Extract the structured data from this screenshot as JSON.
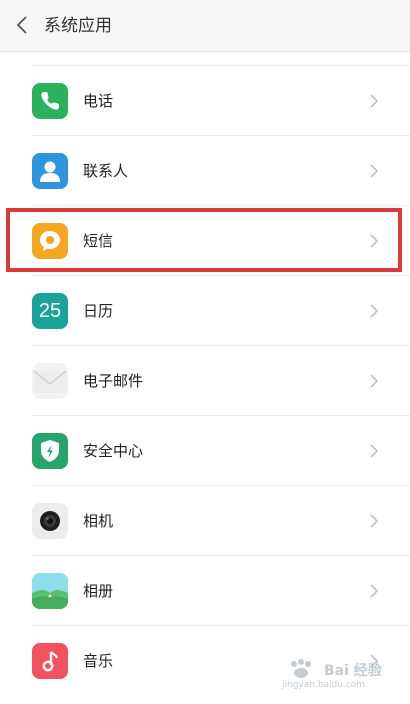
{
  "header": {
    "title": "系统应用",
    "back_icon": "chevron-left-icon"
  },
  "items": [
    {
      "label": "电话",
      "icon": "phone-icon",
      "color": "#2bb15c"
    },
    {
      "label": "联系人",
      "icon": "contacts-icon",
      "color": "#2e95dc"
    },
    {
      "label": "短信",
      "icon": "message-icon",
      "color": "#f5a623"
    },
    {
      "label": "日历",
      "icon": "calendar-icon",
      "color": "#1aa39a",
      "icon_text": "25"
    },
    {
      "label": "电子邮件",
      "icon": "email-icon",
      "color": "#ededed"
    },
    {
      "label": "安全中心",
      "icon": "security-shield-icon",
      "color": "#25a56b"
    },
    {
      "label": "相机",
      "icon": "camera-icon",
      "color": "#ececec"
    },
    {
      "label": "相册",
      "icon": "gallery-icon",
      "color": "#58c06e"
    },
    {
      "label": "音乐",
      "icon": "music-icon",
      "color": "#f0525e"
    }
  ],
  "highlighted_item": "短信",
  "watermark": {
    "text": "Bai 经验",
    "sub": "jingyan.baidu.com"
  }
}
